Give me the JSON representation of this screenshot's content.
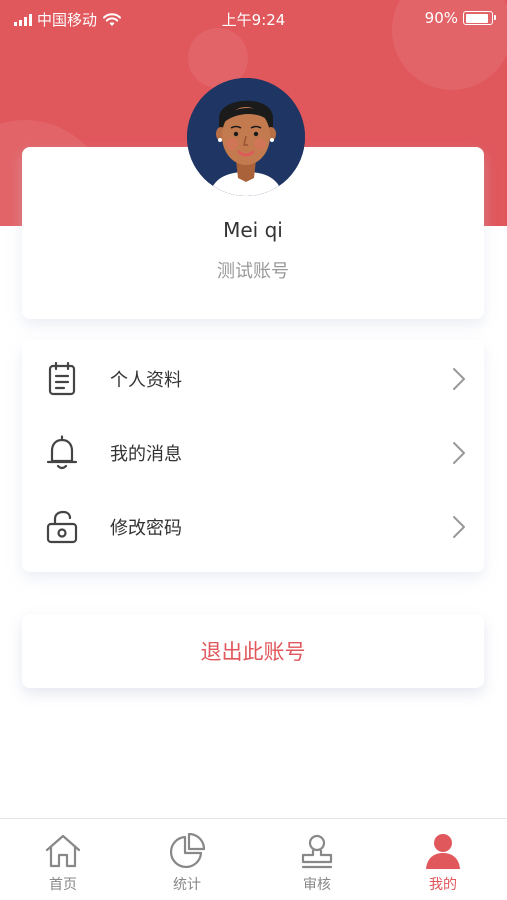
{
  "status_bar": {
    "carrier": "中国移动",
    "time": "上午9:24",
    "battery": "90%",
    "battery_level": 0.9
  },
  "profile": {
    "name": "Mei qi",
    "role": "测试账号"
  },
  "menu": {
    "items": [
      {
        "label": "个人资料",
        "icon": "clipboard-icon"
      },
      {
        "label": "我的消息",
        "icon": "bell-icon"
      },
      {
        "label": "修改密码",
        "icon": "unlock-icon"
      }
    ]
  },
  "logout": {
    "label": "退出此账号"
  },
  "tabbar": {
    "tabs": [
      {
        "label": "首页",
        "icon": "home-icon",
        "active": false
      },
      {
        "label": "统计",
        "icon": "pie-chart-icon",
        "active": false
      },
      {
        "label": "审核",
        "icon": "stamp-icon",
        "active": false
      },
      {
        "label": "我的",
        "icon": "user-icon",
        "active": true
      }
    ]
  },
  "colors": {
    "brand": "#e0575c",
    "avatar_bg": "#1f3563",
    "text_primary": "#333333",
    "text_secondary": "#999999",
    "tab_inactive": "#888888"
  }
}
